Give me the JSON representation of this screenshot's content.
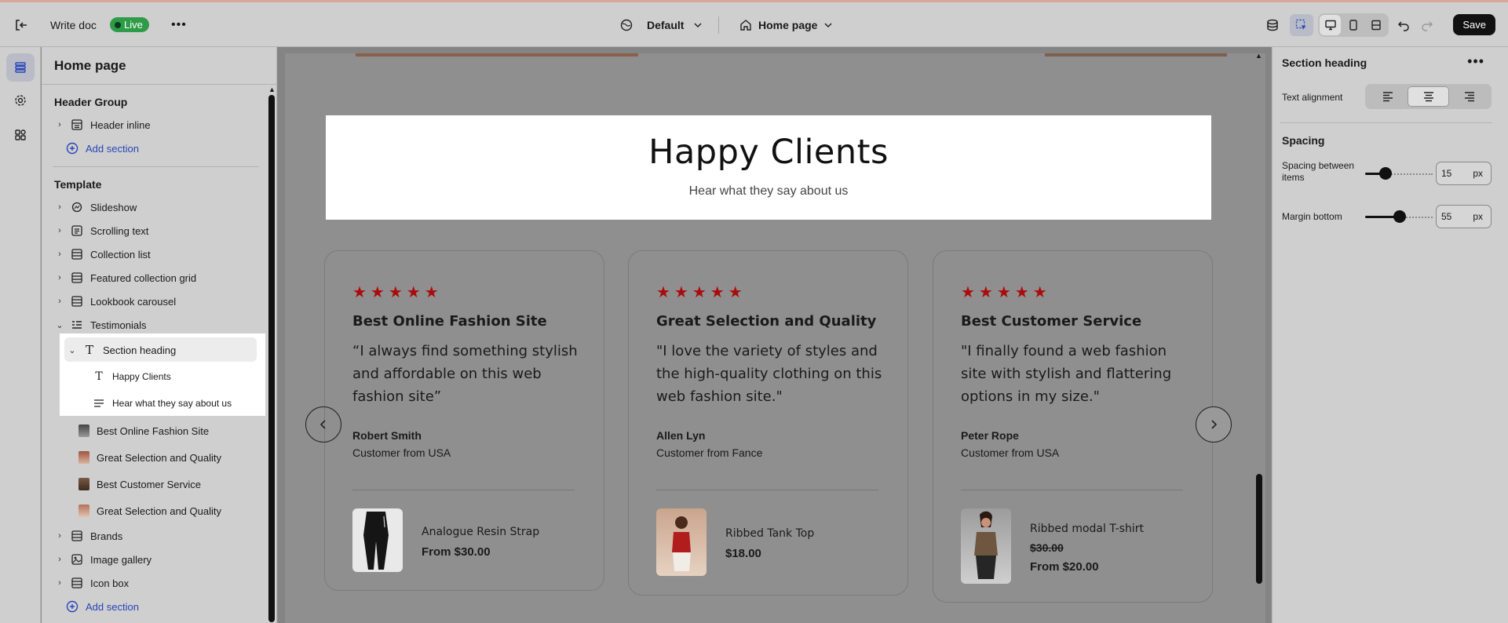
{
  "topbar": {
    "doc_title": "Write doc",
    "live_label": "Live",
    "theme_label": "Default",
    "page_label": "Home page",
    "save_label": "Save"
  },
  "layers": {
    "title": "Home page",
    "header_group": {
      "label": "Header Group",
      "items": [
        {
          "label": "Header inline"
        }
      ],
      "add_label": "Add section"
    },
    "template": {
      "label": "Template",
      "items": [
        {
          "label": "Slideshow"
        },
        {
          "label": "Scrolling text"
        },
        {
          "label": "Collection list"
        },
        {
          "label": "Featured collection grid"
        },
        {
          "label": "Lookbook carousel"
        },
        {
          "label": "Testimonials"
        }
      ],
      "testimonials_children": {
        "section_heading": "Section heading",
        "heading_children": [
          "Happy Clients",
          "Hear what they say about us"
        ],
        "blocks": [
          "Best Online Fashion Site",
          "Great Selection and Quality",
          "Best Customer Service",
          "Great Selection and Quality"
        ]
      },
      "after_items": [
        {
          "label": "Brands"
        },
        {
          "label": "Image gallery"
        },
        {
          "label": "Icon box"
        }
      ],
      "add_label": "Add section"
    }
  },
  "canvas": {
    "heading": "Happy Clients",
    "subheading": "Hear what they say about us",
    "stars": "★★★★★",
    "cards": [
      {
        "title": "Best Online Fashion Site",
        "quote": "“I always find something stylish and affordable on this web fashion site”",
        "name": "Robert Smith",
        "from": "Customer from USA",
        "product": "Analogue Resin Strap",
        "old_price": "",
        "price": "From $30.00"
      },
      {
        "title": "Great Selection and Quality",
        "quote": "\"I love the variety of styles and the high-quality clothing on this web fashion site.\"",
        "name": "Allen Lyn",
        "from": "Customer from Fance",
        "product": "Ribbed Tank Top",
        "old_price": "",
        "price": "$18.00"
      },
      {
        "title": "Best Customer Service",
        "quote": "\"I finally found a web fashion site with stylish and flattering options in my size.\"",
        "name": "Peter Rope",
        "from": "Customer from USA",
        "product": "Ribbed modal T-shirt",
        "old_price": "$30.00",
        "price": "From $20.00"
      }
    ]
  },
  "settings": {
    "title": "Section heading",
    "more": "•••",
    "text_alignment_label": "Text alignment",
    "alignment_selected": "center",
    "spacing_label": "Spacing",
    "spacing_between_label": "Spacing between items",
    "spacing_between_value": "15",
    "margin_bottom_label": "Margin bottom",
    "margin_bottom_value": "55",
    "unit": "px"
  },
  "colors": {
    "accent_blue": "#2746b8",
    "star_red": "#a90c0c",
    "live_green": "#2e9b48"
  }
}
